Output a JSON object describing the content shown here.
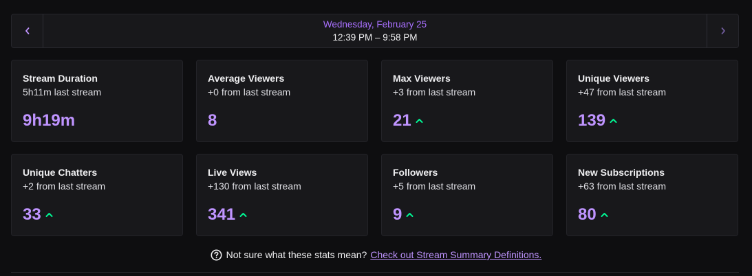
{
  "date_nav": {
    "date": "Wednesday, February 25",
    "time_range": "12:39 PM – 9:58 PM",
    "prev_icon": "chevron-left-icon",
    "next_icon": "chevron-right-icon"
  },
  "stats": [
    {
      "title": "Stream Duration",
      "subtitle": "5h11m last stream",
      "value": "9h19m",
      "trend": "none"
    },
    {
      "title": "Average Viewers",
      "subtitle": "+0 from last stream",
      "value": "8",
      "trend": "none"
    },
    {
      "title": "Max Viewers",
      "subtitle": "+3 from last stream",
      "value": "21",
      "trend": "up"
    },
    {
      "title": "Unique Viewers",
      "subtitle": "+47 from last stream",
      "value": "139",
      "trend": "up"
    },
    {
      "title": "Unique Chatters",
      "subtitle": "+2 from last stream",
      "value": "33",
      "trend": "up"
    },
    {
      "title": "Live Views",
      "subtitle": "+130 from last stream",
      "value": "341",
      "trend": "up"
    },
    {
      "title": "Followers",
      "subtitle": "+5 from last stream",
      "value": "9",
      "trend": "up"
    },
    {
      "title": "New Subscriptions",
      "subtitle": "+63 from last stream",
      "value": "80",
      "trend": "up"
    }
  ],
  "help": {
    "text": "Not sure what these stats mean?",
    "link": "Check out Stream Summary Definitions.",
    "icon": "question-circle-icon"
  },
  "colors": {
    "accent": "#bf94ff",
    "date_accent": "#a970ff",
    "trend_up": "#00f593",
    "card_bg": "#18181b",
    "page_bg": "#0e0e10"
  }
}
